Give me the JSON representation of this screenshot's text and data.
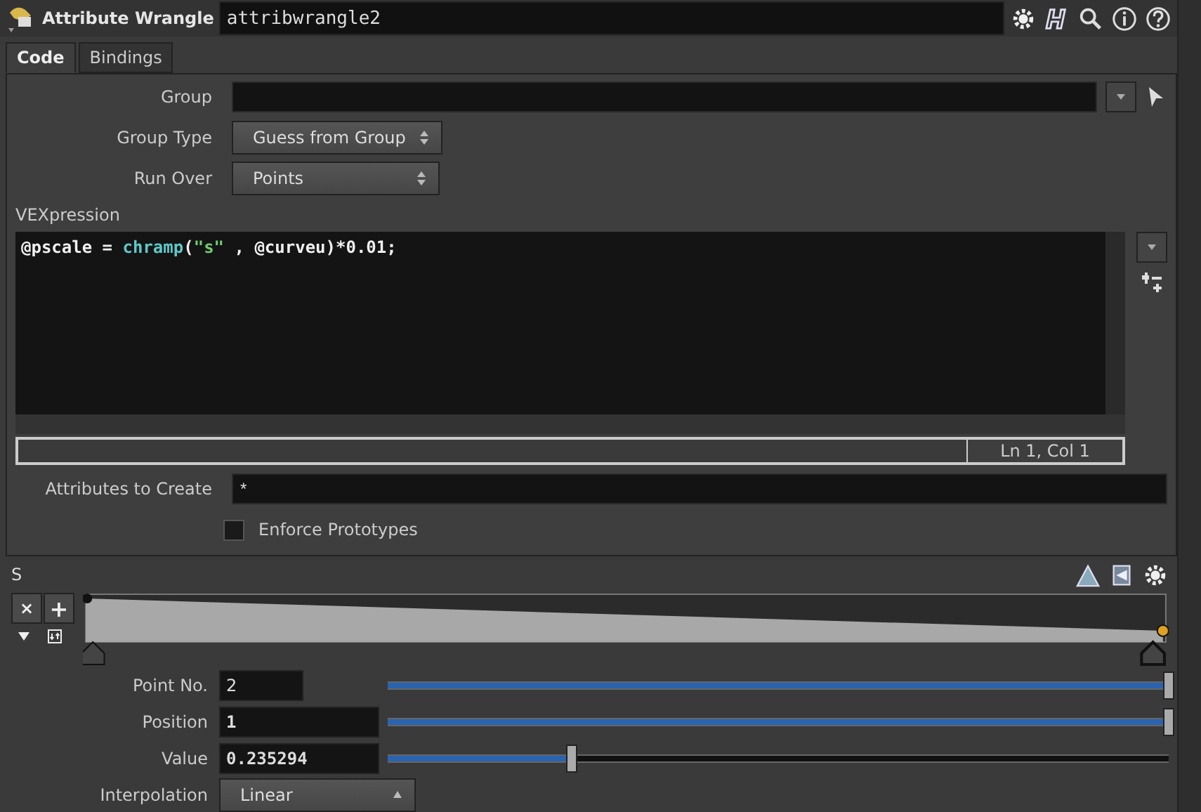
{
  "header": {
    "node_type": "Attribute Wrangle",
    "node_name": "attribwrangle2"
  },
  "tabs": [
    {
      "label": "Code",
      "selected": true
    },
    {
      "label": "Bindings",
      "selected": false
    }
  ],
  "group": {
    "label": "Group"
  },
  "group_type": {
    "label": "Group Type",
    "value": "Guess from Group"
  },
  "run_over": {
    "label": "Run Over",
    "value": "Points"
  },
  "vexpression": {
    "label": "VEXpression",
    "code_tokens": [
      {
        "kind": "plain",
        "text": "@pscale = "
      },
      {
        "kind": "function",
        "text": "chramp"
      },
      {
        "kind": "plain",
        "text": "("
      },
      {
        "kind": "string",
        "text": "\"s\""
      },
      {
        "kind": "plain",
        "text": " , @curveu)*0.01;"
      }
    ],
    "cursor": "Ln 1, Col 1"
  },
  "attributes_to_create": {
    "label": "Attributes to Create",
    "value": "*"
  },
  "enforce_prototypes": {
    "label": "Enforce Prototypes",
    "checked": false
  },
  "ramp": {
    "label": "S",
    "remove_key": "×",
    "add_key": "+",
    "fields": [
      {
        "label": "Point No.",
        "value": "2",
        "level": 1,
        "kind": "int"
      },
      {
        "label": "Position",
        "value": "1",
        "level": 1,
        "kind": "float"
      },
      {
        "label": "Value",
        "value": "0.235294",
        "level": 0.235,
        "kind": "float"
      }
    ],
    "interpolation": {
      "label": "Interpolation",
      "value": "Linear"
    }
  }
}
